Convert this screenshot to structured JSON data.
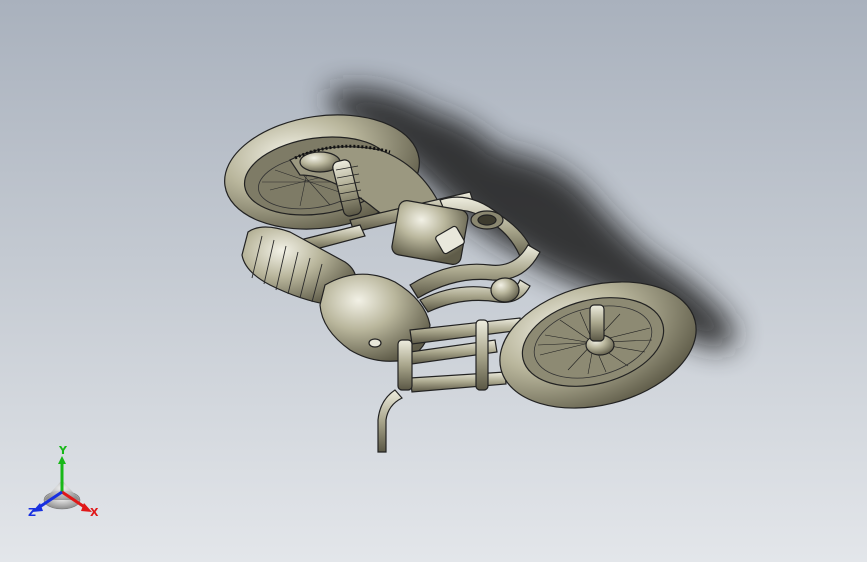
{
  "triad": {
    "x_label": "X",
    "y_label": "Y",
    "z_label": "Z"
  },
  "colors": {
    "background_top": "#a9b1bd",
    "background_bottom": "#e3e6ea",
    "model": "#a6a389",
    "shadow": "#1e1e1e",
    "x_axis": "#e01818",
    "y_axis": "#18b818",
    "z_axis": "#1830e0"
  },
  "model": {
    "name_icon": "motorcycle-3d-model"
  }
}
